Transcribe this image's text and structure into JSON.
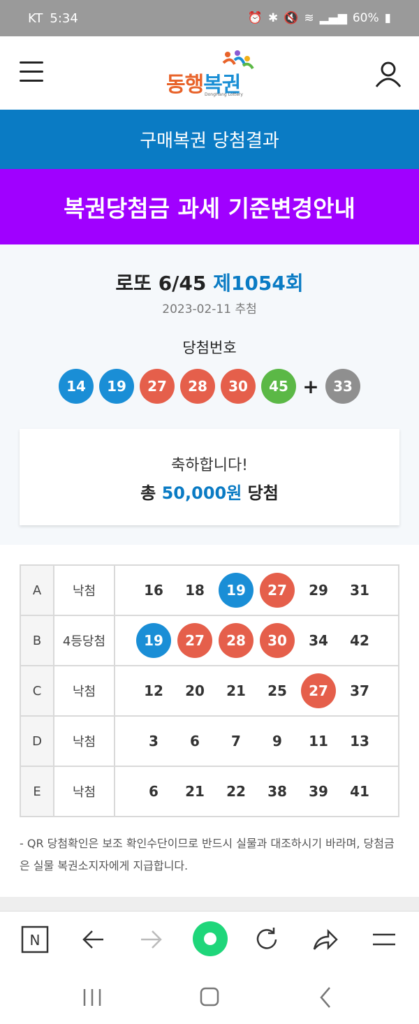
{
  "status_bar": {
    "carrier": "KT",
    "time": "5:34",
    "battery": "60%"
  },
  "header": {
    "logo_text_1": "동행",
    "logo_text_2": "복권",
    "logo_sub": "DongHang Lottery"
  },
  "banners": {
    "purchase_result": "구매복권 당첨결과",
    "tax_notice": "복권당첨금 과세 기준변경안내"
  },
  "draw": {
    "game": "로또 6/45 ",
    "round": "제1054회",
    "date": "2023-02-11 추첨",
    "win_label": "당첨번호",
    "numbers": [
      {
        "value": "14",
        "color": "#1a8ed6"
      },
      {
        "value": "19",
        "color": "#1a8ed6"
      },
      {
        "value": "27",
        "color": "#e55f4b"
      },
      {
        "value": "28",
        "color": "#e55f4b"
      },
      {
        "value": "30",
        "color": "#e55f4b"
      },
      {
        "value": "45",
        "color": "#5bb846"
      }
    ],
    "plus": "+",
    "bonus": {
      "value": "33",
      "color": "#8f8f8f"
    }
  },
  "congrats": {
    "message": "축하합니다!",
    "prefix": "총 ",
    "amount": "50,000원",
    "suffix": " 당첨"
  },
  "tickets": [
    {
      "letter": "A",
      "result": "낙첨",
      "numbers": [
        {
          "value": "16",
          "color": ""
        },
        {
          "value": "18",
          "color": ""
        },
        {
          "value": "19",
          "color": "#1a8ed6"
        },
        {
          "value": "27",
          "color": "#e55f4b"
        },
        {
          "value": "29",
          "color": ""
        },
        {
          "value": "31",
          "color": ""
        }
      ]
    },
    {
      "letter": "B",
      "result": "4등당첨",
      "numbers": [
        {
          "value": "19",
          "color": "#1a8ed6"
        },
        {
          "value": "27",
          "color": "#e55f4b"
        },
        {
          "value": "28",
          "color": "#e55f4b"
        },
        {
          "value": "30",
          "color": "#e55f4b"
        },
        {
          "value": "34",
          "color": ""
        },
        {
          "value": "42",
          "color": ""
        }
      ]
    },
    {
      "letter": "C",
      "result": "낙첨",
      "numbers": [
        {
          "value": "12",
          "color": ""
        },
        {
          "value": "20",
          "color": ""
        },
        {
          "value": "21",
          "color": ""
        },
        {
          "value": "25",
          "color": ""
        },
        {
          "value": "27",
          "color": "#e55f4b"
        },
        {
          "value": "37",
          "color": ""
        }
      ]
    },
    {
      "letter": "D",
      "result": "낙첨",
      "numbers": [
        {
          "value": "3",
          "color": ""
        },
        {
          "value": "6",
          "color": ""
        },
        {
          "value": "7",
          "color": ""
        },
        {
          "value": "9",
          "color": ""
        },
        {
          "value": "11",
          "color": ""
        },
        {
          "value": "13",
          "color": ""
        }
      ]
    },
    {
      "letter": "E",
      "result": "낙첨",
      "numbers": [
        {
          "value": "6",
          "color": ""
        },
        {
          "value": "21",
          "color": ""
        },
        {
          "value": "22",
          "color": ""
        },
        {
          "value": "38",
          "color": ""
        },
        {
          "value": "39",
          "color": ""
        },
        {
          "value": "41",
          "color": ""
        }
      ]
    }
  ],
  "notice": "- QR 당첨확인은 보조 확인수단이므로 반드시 실물과 대조하시기 바라며, 당첨금은 실물 복권소지자에게 지급합니다.",
  "browser_bar": [
    "naver-n-icon",
    "back-arrow-icon",
    "forward-arrow-icon",
    "green-dot-icon",
    "refresh-icon",
    "share-icon",
    "menu-icon"
  ],
  "colors": {
    "blue": "#0a7bc4",
    "purple": "#a000ff"
  }
}
